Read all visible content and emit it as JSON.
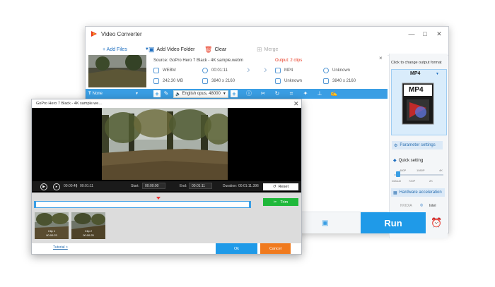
{
  "app": {
    "title": "Video Converter"
  },
  "window_controls": {
    "minimize": "—",
    "maximize": "□",
    "close": "✕"
  },
  "toolbar": {
    "add_files": "+ Add Files",
    "add_video_folder": "Add Video Folder",
    "clear": "Clear",
    "merge": "Merge"
  },
  "file_item": {
    "source": "Source: GoPro Hero 7 Black - 4K sample.webm",
    "output": "Output: 2 clips",
    "src_format": "WEBM",
    "src_duration": "00:01:11",
    "src_size": "242.30 MB",
    "src_resolution": "3840 x 2160",
    "out_format": "MP4",
    "out_duration": "Unknown",
    "out_size": "Unknown",
    "out_resolution": "3840 x 2160",
    "close": "×"
  },
  "subbar": {
    "subtitle": "None",
    "audio": "English opus, 48000"
  },
  "right_panel": {
    "click_label": "Click to change output format",
    "format": "MP4",
    "format_badge": "MP4",
    "parameter_settings": "Parameter settings",
    "quick_setting": "Quick setting",
    "ticks_top": [
      "480P",
      "1080P",
      "4K"
    ],
    "ticks_bottom": [
      "Default",
      "720P",
      "2K"
    ],
    "hardware_acceleration": "Hardware acceleration",
    "nvidia": "NVIDIA",
    "intel": "Intel",
    "slider_level": 0.05
  },
  "run_label": "Run",
  "trim_dialog": {
    "title": "GoPro Hero 7 Black - 4K sample.we...",
    "close": "✕",
    "time_current": "00:00:46",
    "time_total": "00:01:11",
    "start_label": "Start:",
    "start_value": "00:00:00",
    "end_label": "End:",
    "end_value": "00:01:11",
    "duration_label": "Duration:",
    "duration_value": "00:01:11.396",
    "reset": "Reset",
    "trim": "Trim",
    "clips": [
      {
        "name": "Clip 1",
        "time": "00:00:23"
      },
      {
        "name": "Clip 2",
        "time": "00:00:25"
      }
    ],
    "tutorial": "Tutorial >",
    "ok": "Ok",
    "cancel": "Cancel"
  },
  "colors": {
    "accent": "#1f9ae8",
    "trim_green": "#1fb83a",
    "cancel_orange": "#f07a1e",
    "output_red": "#e8361e"
  }
}
